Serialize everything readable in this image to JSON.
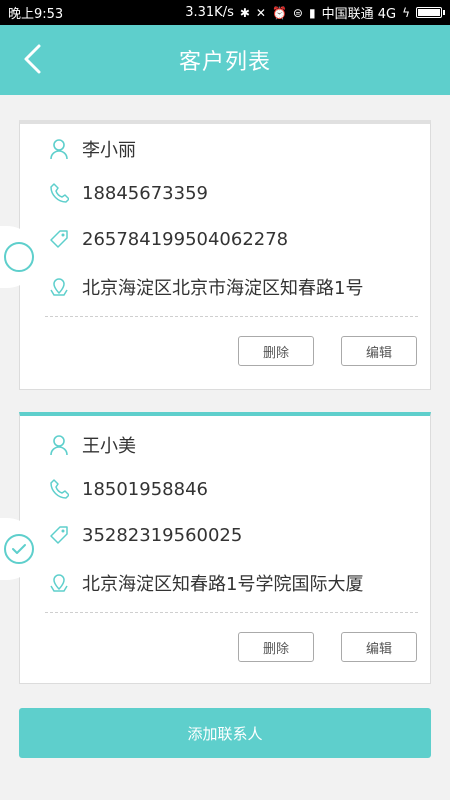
{
  "status": {
    "time": "晚上9:53",
    "speed": "3.31K/s",
    "carrier": "中国联通 4G"
  },
  "header": {
    "title": "客户列表"
  },
  "customers": [
    {
      "name": "李小丽",
      "phone": "18845673359",
      "id_number": "265784199504062278",
      "address": "北京海淀区北京市海淀区知春路1号",
      "delete_label": "删除",
      "edit_label": "编辑",
      "selected": false
    },
    {
      "name": "王小美",
      "phone": "18501958846",
      "id_number": "35282319560025",
      "address": "北京海淀区知春路1号学院国际大厦",
      "delete_label": "删除",
      "edit_label": "编辑",
      "selected": true
    }
  ],
  "footer": {
    "add_label": "添加联系人"
  },
  "colors": {
    "accent": "#5ecfcc",
    "text": "#333333"
  }
}
